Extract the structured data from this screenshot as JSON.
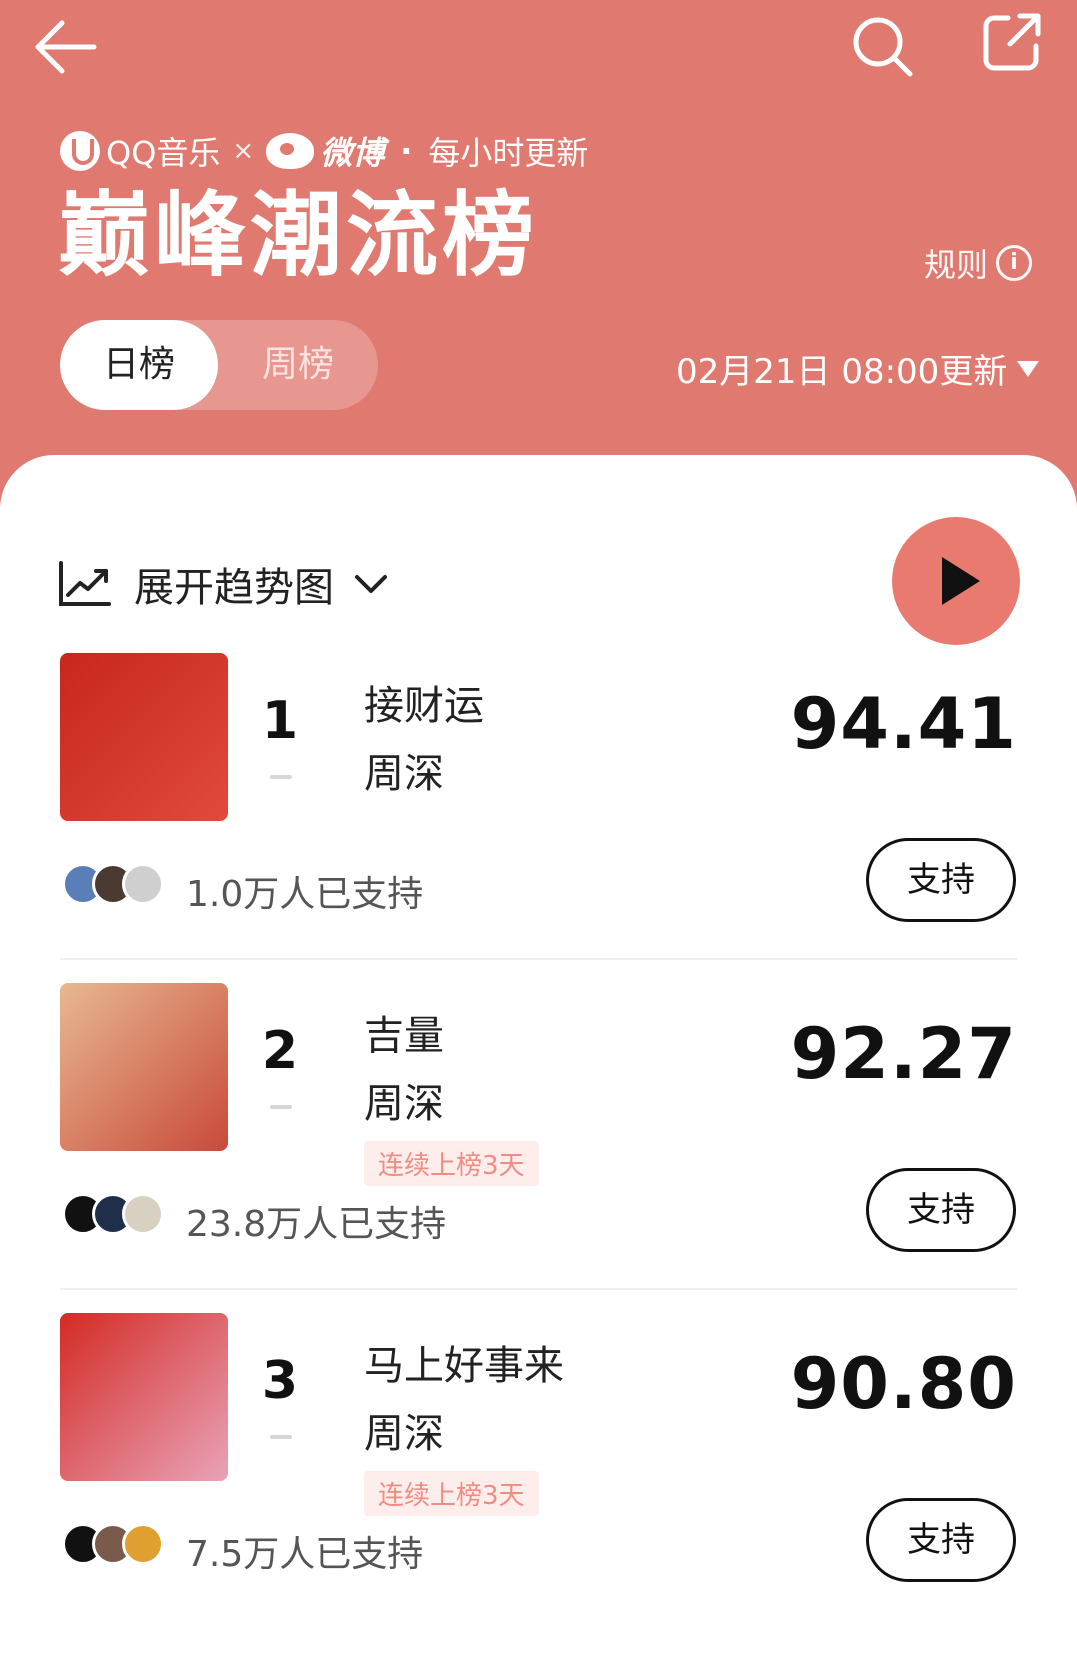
{
  "header": {
    "brand_qq": "QQ音乐",
    "brand_times": "×",
    "brand_weibo": "微博",
    "brand_dot": "·",
    "brand_update_freq": "每小时更新",
    "title": "巅峰潮流榜",
    "rules_label": "规则",
    "rules_icon_glyph": "i",
    "tabs": [
      {
        "label": "日榜",
        "active": true
      },
      {
        "label": "周榜",
        "active": false
      }
    ],
    "update_text": "02月21日 08:00更新"
  },
  "toolbar": {
    "trend_label": "展开趋势图"
  },
  "items": [
    {
      "rank": "1",
      "song": "接财运",
      "artist": "周深",
      "badge": "",
      "score": "94.41",
      "supporters": "1.0万人已支持",
      "support_label": "支持",
      "cover_colors": [
        "#c8261e",
        "#e04a3c"
      ],
      "avatar_colors": [
        "#5a7fb8",
        "#4a3a32",
        "#cfcfcf"
      ]
    },
    {
      "rank": "2",
      "song": "吉量",
      "artist": "周深",
      "badge": "连续上榜3天",
      "score": "92.27",
      "supporters": "23.8万人已支持",
      "support_label": "支持",
      "cover_colors": [
        "#e8b890",
        "#c84a3a"
      ],
      "avatar_colors": [
        "#111111",
        "#1f2f4a",
        "#d8d0c0"
      ]
    },
    {
      "rank": "3",
      "song": "马上好事来",
      "artist": "周深",
      "badge": "连续上榜3天",
      "score": "90.80",
      "supporters": "7.5万人已支持",
      "support_label": "支持",
      "cover_colors": [
        "#d42a24",
        "#e9a3b8"
      ],
      "avatar_colors": [
        "#111111",
        "#7a5a4a",
        "#e0a030"
      ]
    }
  ],
  "colors": {
    "header_bg": "#e07a70",
    "play_button": "#e97a70",
    "badge_text": "#f08d82",
    "badge_bg": "#fdeeec"
  }
}
